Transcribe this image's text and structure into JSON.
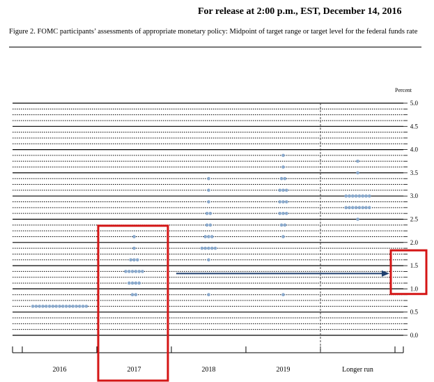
{
  "header": {
    "release_line": "For release at 2:00 p.m., EST, December 14, 2016",
    "figure_caption": "Figure 2. FOMC participants’ assessments of appropriate monetary policy: Midpoint of target range or target level for the federal funds rate"
  },
  "chart_data": {
    "type": "scatter",
    "title": "",
    "xlabel": "",
    "ylabel": "Percent",
    "ylim": [
      0,
      5
    ],
    "y_tick_step": 0.125,
    "y_tick_labels": [
      "0.0",
      "0.5",
      "1.0",
      "1.5",
      "2.0",
      "2.5",
      "3.0",
      "3.5",
      "4.0",
      "4.5",
      "5.0"
    ],
    "categories": [
      "2016",
      "2017",
      "2018",
      "2019",
      "Longer run"
    ],
    "dot_color": "#8aa9cc",
    "dots": {
      "2016": [
        [
          0.625,
          17
        ]
      ],
      "2017": [
        [
          0.875,
          2
        ],
        [
          1.125,
          4
        ],
        [
          1.375,
          6
        ],
        [
          1.625,
          3
        ],
        [
          1.875,
          1
        ],
        [
          2.125,
          1
        ]
      ],
      "2018": [
        [
          0.875,
          1
        ],
        [
          1.625,
          1
        ],
        [
          1.875,
          5
        ],
        [
          2.125,
          3
        ],
        [
          2.375,
          2
        ],
        [
          2.625,
          2
        ],
        [
          2.875,
          1
        ],
        [
          3.125,
          1
        ],
        [
          3.375,
          1
        ]
      ],
      "2019": [
        [
          0.875,
          1
        ],
        [
          2.125,
          1
        ],
        [
          2.375,
          2
        ],
        [
          2.625,
          3
        ],
        [
          2.875,
          3
        ],
        [
          3.125,
          3
        ],
        [
          3.375,
          2
        ],
        [
          3.625,
          1
        ],
        [
          3.875,
          1
        ]
      ],
      "Longer run": [
        [
          2.5,
          1
        ],
        [
          2.75,
          8
        ],
        [
          3.0,
          8
        ],
        [
          3.5,
          1
        ],
        [
          3.75,
          1
        ]
      ]
    },
    "grid": true,
    "divider_before": "Longer run",
    "annotations": {
      "arrow": {
        "from_category": "2018",
        "to_category": "Longer run",
        "y": 1.375,
        "color": "#1f3f6e"
      },
      "highlight_color": "#d41515",
      "highlight_boxes": [
        "2017 column",
        "right axis 1.0–1.75"
      ]
    }
  }
}
